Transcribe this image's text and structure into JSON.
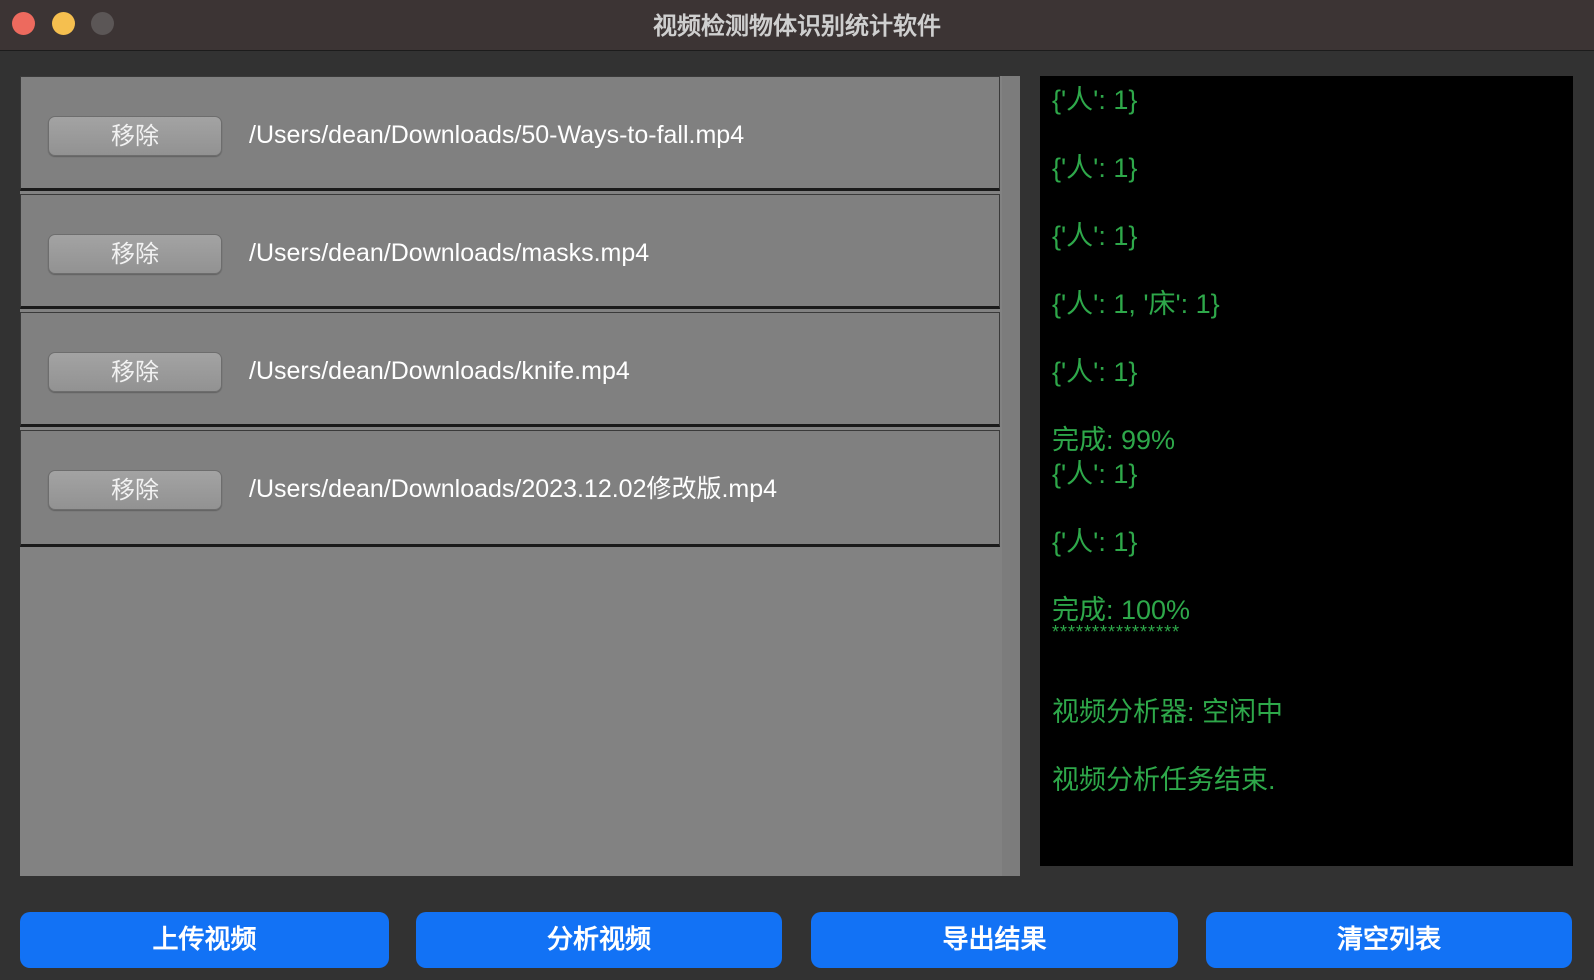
{
  "window": {
    "title": "视频检测物体识别统计软件"
  },
  "files": [
    {
      "remove_label": "移除",
      "path": "/Users/dean/Downloads/50-Ways-to-fall.mp4"
    },
    {
      "remove_label": "移除",
      "path": "/Users/dean/Downloads/masks.mp4"
    },
    {
      "remove_label": "移除",
      "path": "/Users/dean/Downloads/knife.mp4"
    },
    {
      "remove_label": "移除",
      "path": "/Users/dean/Downloads/2023.12.02修改版.mp4"
    }
  ],
  "log": [
    "{'人': 1}",
    "{'人': 1}",
    "{'人': 1}",
    "{'人': 1, '床': 1}",
    "{'人': 1}",
    "完成: 99%",
    "{'人': 1}",
    "{'人': 1}",
    "完成: 100%",
    "****************",
    "视频分析器: 空闲中",
    "视频分析任务结束."
  ],
  "buttons": {
    "upload": "上传视频",
    "analyze": "分析视频",
    "export": "导出结果",
    "clear": "清空列表"
  },
  "colors": {
    "log_text": "#2ea84a",
    "accent_button": "#1272f5",
    "window_bg": "#323232",
    "list_bg": "#828282"
  }
}
